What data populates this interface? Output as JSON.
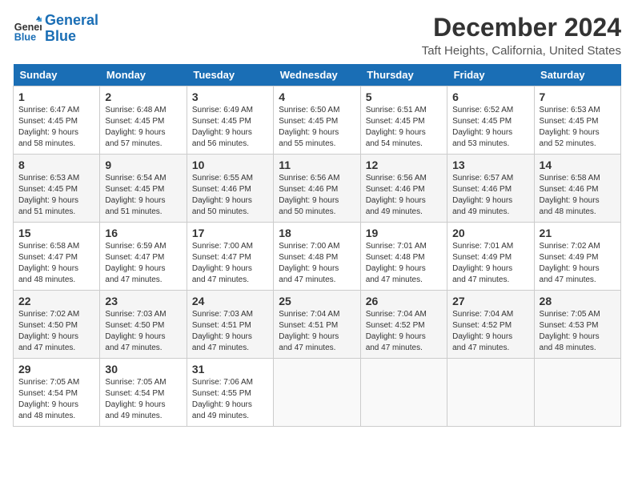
{
  "header": {
    "logo_line1": "General",
    "logo_line2": "Blue",
    "month_title": "December 2024",
    "location": "Taft Heights, California, United States"
  },
  "weekdays": [
    "Sunday",
    "Monday",
    "Tuesday",
    "Wednesday",
    "Thursday",
    "Friday",
    "Saturday"
  ],
  "weeks": [
    [
      {
        "day": 1,
        "info": "Sunrise: 6:47 AM\nSunset: 4:45 PM\nDaylight: 9 hours\nand 58 minutes."
      },
      {
        "day": 2,
        "info": "Sunrise: 6:48 AM\nSunset: 4:45 PM\nDaylight: 9 hours\nand 57 minutes."
      },
      {
        "day": 3,
        "info": "Sunrise: 6:49 AM\nSunset: 4:45 PM\nDaylight: 9 hours\nand 56 minutes."
      },
      {
        "day": 4,
        "info": "Sunrise: 6:50 AM\nSunset: 4:45 PM\nDaylight: 9 hours\nand 55 minutes."
      },
      {
        "day": 5,
        "info": "Sunrise: 6:51 AM\nSunset: 4:45 PM\nDaylight: 9 hours\nand 54 minutes."
      },
      {
        "day": 6,
        "info": "Sunrise: 6:52 AM\nSunset: 4:45 PM\nDaylight: 9 hours\nand 53 minutes."
      },
      {
        "day": 7,
        "info": "Sunrise: 6:53 AM\nSunset: 4:45 PM\nDaylight: 9 hours\nand 52 minutes."
      }
    ],
    [
      {
        "day": 8,
        "info": "Sunrise: 6:53 AM\nSunset: 4:45 PM\nDaylight: 9 hours\nand 51 minutes."
      },
      {
        "day": 9,
        "info": "Sunrise: 6:54 AM\nSunset: 4:45 PM\nDaylight: 9 hours\nand 51 minutes."
      },
      {
        "day": 10,
        "info": "Sunrise: 6:55 AM\nSunset: 4:46 PM\nDaylight: 9 hours\nand 50 minutes."
      },
      {
        "day": 11,
        "info": "Sunrise: 6:56 AM\nSunset: 4:46 PM\nDaylight: 9 hours\nand 50 minutes."
      },
      {
        "day": 12,
        "info": "Sunrise: 6:56 AM\nSunset: 4:46 PM\nDaylight: 9 hours\nand 49 minutes."
      },
      {
        "day": 13,
        "info": "Sunrise: 6:57 AM\nSunset: 4:46 PM\nDaylight: 9 hours\nand 49 minutes."
      },
      {
        "day": 14,
        "info": "Sunrise: 6:58 AM\nSunset: 4:46 PM\nDaylight: 9 hours\nand 48 minutes."
      }
    ],
    [
      {
        "day": 15,
        "info": "Sunrise: 6:58 AM\nSunset: 4:47 PM\nDaylight: 9 hours\nand 48 minutes."
      },
      {
        "day": 16,
        "info": "Sunrise: 6:59 AM\nSunset: 4:47 PM\nDaylight: 9 hours\nand 47 minutes."
      },
      {
        "day": 17,
        "info": "Sunrise: 7:00 AM\nSunset: 4:47 PM\nDaylight: 9 hours\nand 47 minutes."
      },
      {
        "day": 18,
        "info": "Sunrise: 7:00 AM\nSunset: 4:48 PM\nDaylight: 9 hours\nand 47 minutes."
      },
      {
        "day": 19,
        "info": "Sunrise: 7:01 AM\nSunset: 4:48 PM\nDaylight: 9 hours\nand 47 minutes."
      },
      {
        "day": 20,
        "info": "Sunrise: 7:01 AM\nSunset: 4:49 PM\nDaylight: 9 hours\nand 47 minutes."
      },
      {
        "day": 21,
        "info": "Sunrise: 7:02 AM\nSunset: 4:49 PM\nDaylight: 9 hours\nand 47 minutes."
      }
    ],
    [
      {
        "day": 22,
        "info": "Sunrise: 7:02 AM\nSunset: 4:50 PM\nDaylight: 9 hours\nand 47 minutes."
      },
      {
        "day": 23,
        "info": "Sunrise: 7:03 AM\nSunset: 4:50 PM\nDaylight: 9 hours\nand 47 minutes."
      },
      {
        "day": 24,
        "info": "Sunrise: 7:03 AM\nSunset: 4:51 PM\nDaylight: 9 hours\nand 47 minutes."
      },
      {
        "day": 25,
        "info": "Sunrise: 7:04 AM\nSunset: 4:51 PM\nDaylight: 9 hours\nand 47 minutes."
      },
      {
        "day": 26,
        "info": "Sunrise: 7:04 AM\nSunset: 4:52 PM\nDaylight: 9 hours\nand 47 minutes."
      },
      {
        "day": 27,
        "info": "Sunrise: 7:04 AM\nSunset: 4:52 PM\nDaylight: 9 hours\nand 47 minutes."
      },
      {
        "day": 28,
        "info": "Sunrise: 7:05 AM\nSunset: 4:53 PM\nDaylight: 9 hours\nand 48 minutes."
      }
    ],
    [
      {
        "day": 29,
        "info": "Sunrise: 7:05 AM\nSunset: 4:54 PM\nDaylight: 9 hours\nand 48 minutes."
      },
      {
        "day": 30,
        "info": "Sunrise: 7:05 AM\nSunset: 4:54 PM\nDaylight: 9 hours\nand 49 minutes."
      },
      {
        "day": 31,
        "info": "Sunrise: 7:06 AM\nSunset: 4:55 PM\nDaylight: 9 hours\nand 49 minutes."
      },
      null,
      null,
      null,
      null
    ]
  ]
}
